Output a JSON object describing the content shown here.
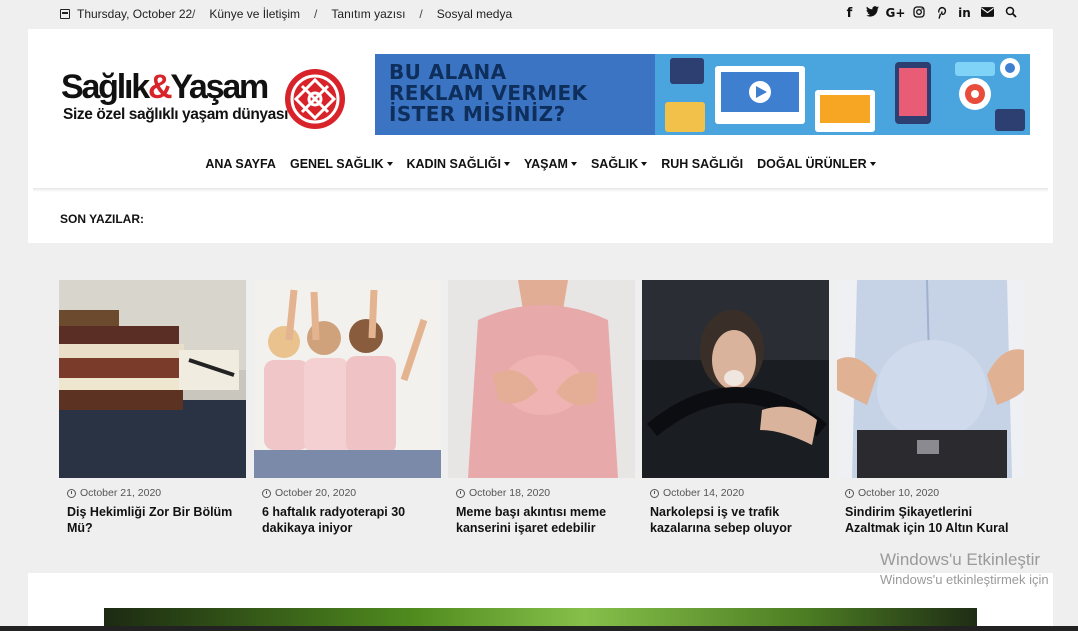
{
  "topbar": {
    "date": "Thursday, October 22",
    "links": [
      "Künye ve İletişim",
      "Tanıtım yazısı",
      "Sosyal medya"
    ],
    "separator": "/",
    "social_icons": [
      "facebook-icon",
      "twitter-icon",
      "google-plus-icon",
      "instagram-icon",
      "pinterest-icon",
      "linkedin-icon",
      "mail-icon",
      "search-icon"
    ]
  },
  "logo": {
    "name_part1": "Sağlık",
    "ampersand": "&",
    "name_part2": "Yaşam",
    "tagline": "Size özel sağlıklı yaşam dünyası"
  },
  "banner": {
    "lines": [
      "BU ALANA",
      "REKLAM VERMEK",
      "İSTER MİSİNİZ?"
    ],
    "bg_color": "#3c74c4"
  },
  "nav": {
    "items": [
      {
        "label": "ANA SAYFA",
        "dropdown": false
      },
      {
        "label": "GENEL SAĞLIK",
        "dropdown": true
      },
      {
        "label": "KADIN SAĞLIĞI",
        "dropdown": true
      },
      {
        "label": "YAŞAM",
        "dropdown": true
      },
      {
        "label": "SAĞLIK",
        "dropdown": true
      },
      {
        "label": "RUH SAĞLIĞI",
        "dropdown": false
      },
      {
        "label": "DOĞAL ÜRÜNLER",
        "dropdown": true
      }
    ]
  },
  "recent": {
    "label": "SON YAZILAR:"
  },
  "posts": [
    {
      "date": "October 21, 2020",
      "title": "Diş Hekimliği Zor Bir Bölüm Mü?"
    },
    {
      "date": "October 20, 2020",
      "title": "6 haftalık radyoterapi 30 dakikaya iniyor"
    },
    {
      "date": "October 18, 2020",
      "title": "Meme başı akıntısı meme kanserini işaret edebilir"
    },
    {
      "date": "October 14, 2020",
      "title": "Narkolepsi iş ve trafik kazalarına sebep oluyor"
    },
    {
      "date": "October 10, 2020",
      "title": "Sindirim Şikayetlerini Azaltmak için 10 Altın Kural"
    }
  ],
  "watermark": {
    "line1": "Windows'u Etkinleştir",
    "line2": "Windows'u etkinleştirmek için"
  },
  "colors": {
    "brand_red": "#d8232a",
    "page_bg": "#efefef"
  }
}
